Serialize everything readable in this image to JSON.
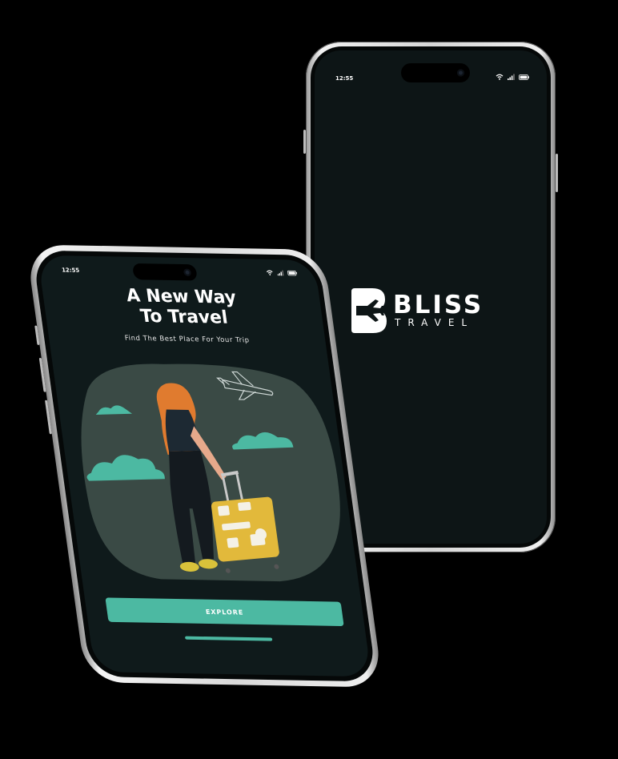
{
  "right_phone": {
    "status_time": "12:55",
    "status_icons": [
      "wifi-icon",
      "cellular-signal-icon",
      "battery-icon"
    ],
    "brand": {
      "name": "BLISS",
      "subtitle": "TRAVEL"
    },
    "colors": {
      "screen_bg": "#0d1516",
      "logo": "#ffffff"
    }
  },
  "left_phone": {
    "status_time": "12:55",
    "status_icons": [
      "wifi-icon",
      "cellular-signal-icon",
      "battery-icon"
    ],
    "title_line1": "A New Way",
    "title_line2": "To Travel",
    "subtitle": "Find The Best Place For Your Trip",
    "illustration": "woman-with-suitcase-illustration",
    "explore_button": "EXPLORE",
    "colors": {
      "accent": "#4cb9a2",
      "screen_bg": "#0f1a1b",
      "suitcase": "#e2b93b",
      "hair": "#e07b2f"
    }
  }
}
